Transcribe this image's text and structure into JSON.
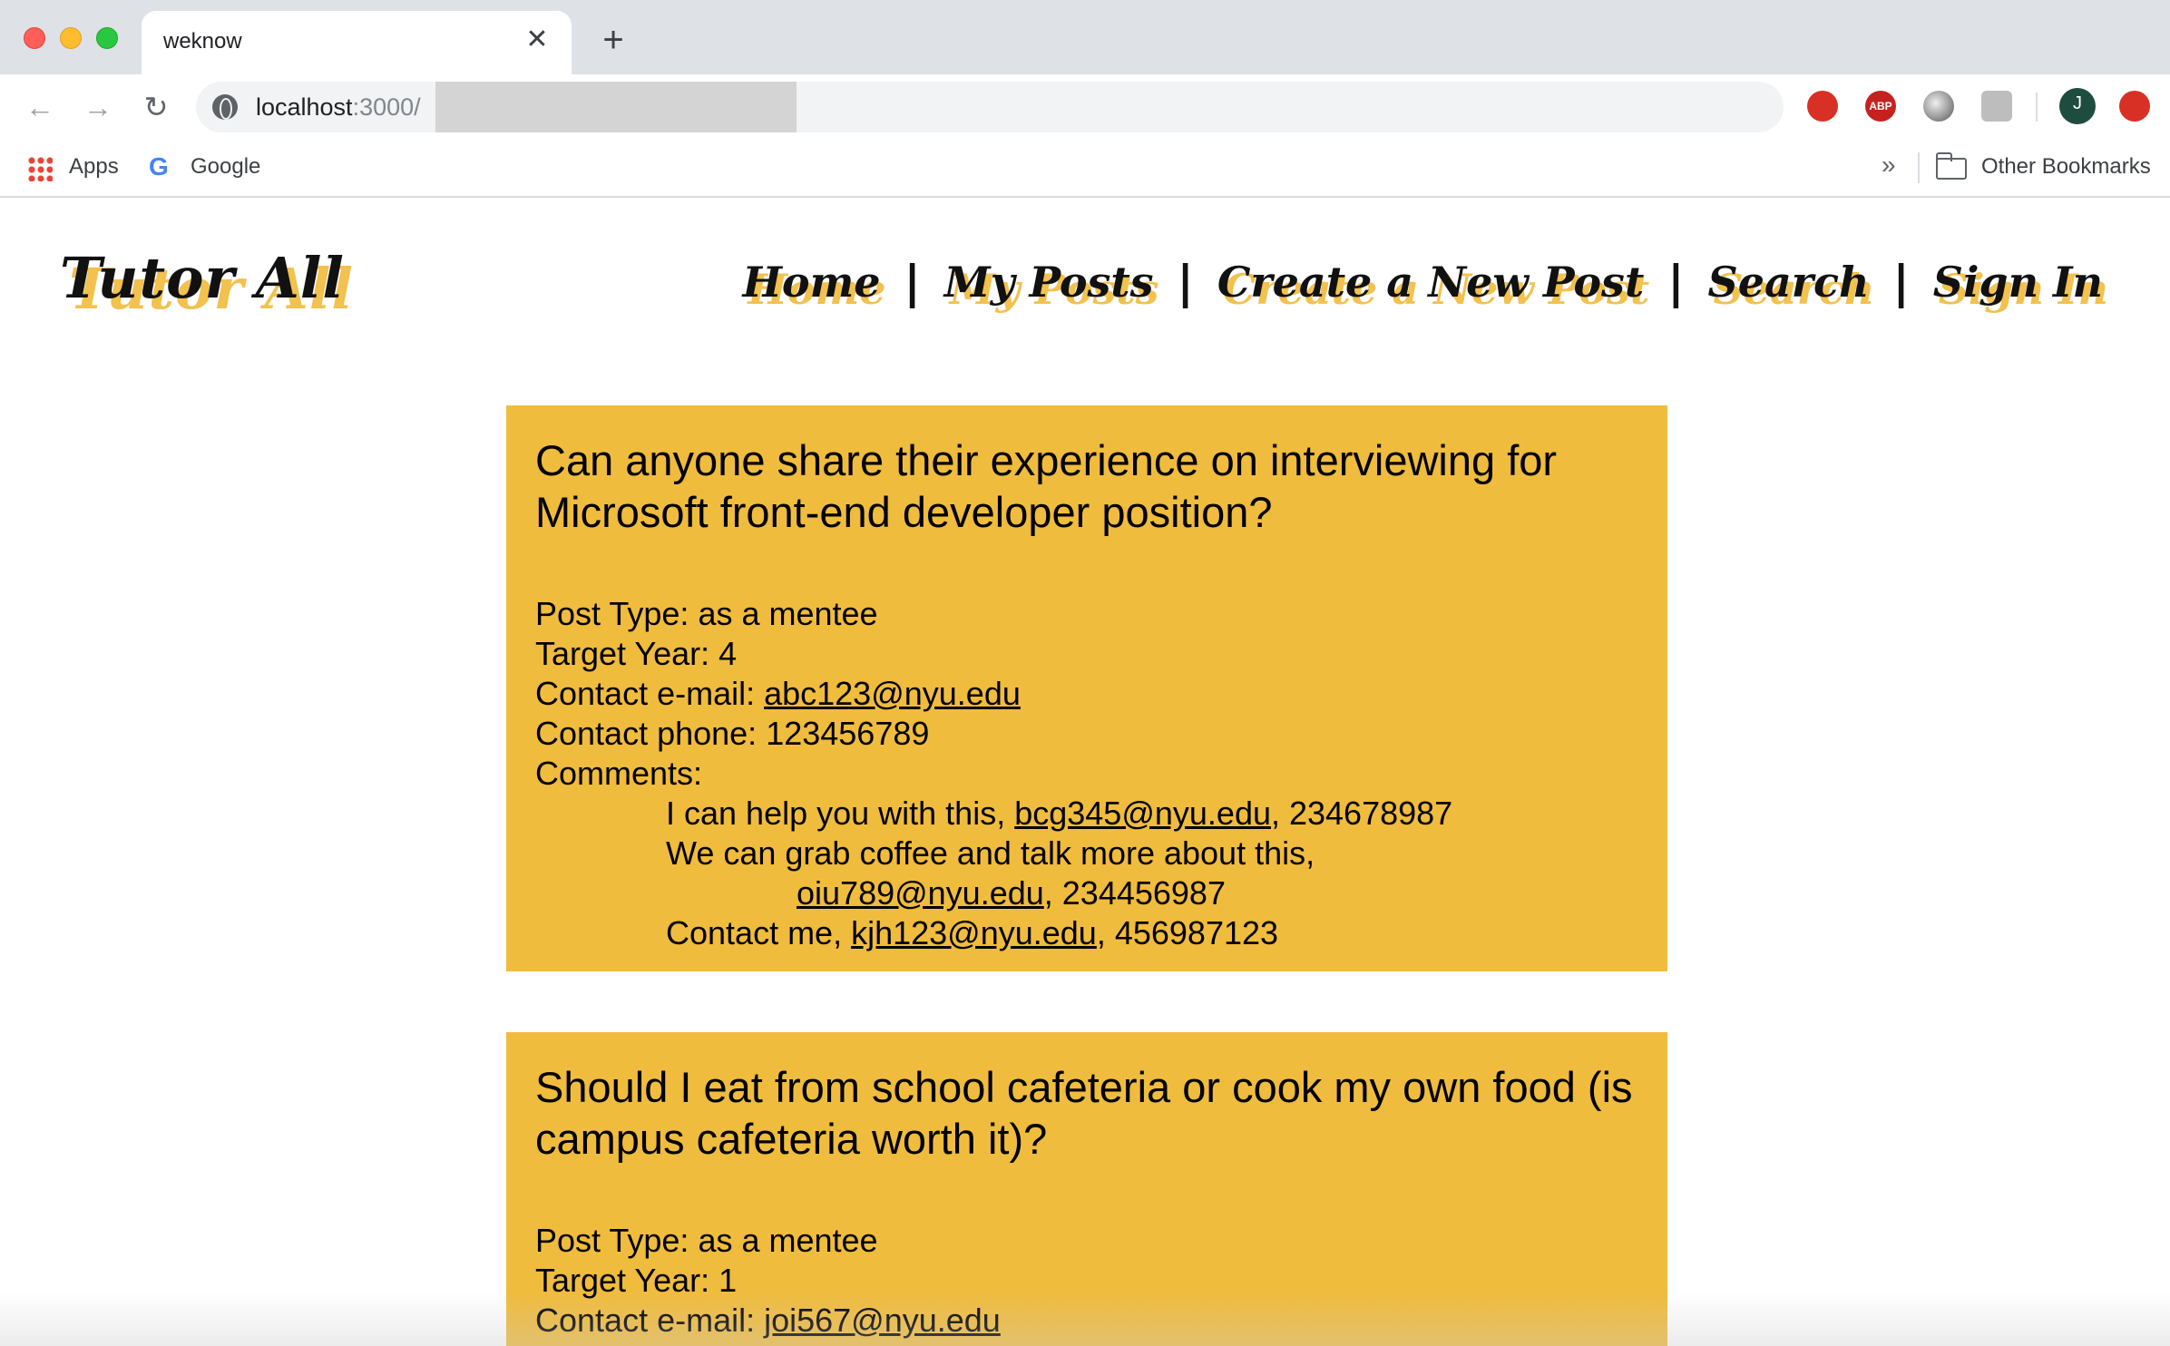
{
  "browser": {
    "tab_title": "weknow",
    "tab_close": "✕",
    "new_tab": "+",
    "url_host": "localhost",
    "url_rest": ":3000/",
    "back_icon": "←",
    "forward_icon": "→",
    "reload_icon": "↻",
    "extension_avatar_letter": "J",
    "extension_abp_label": "ABP",
    "bookmarks": {
      "apps": "Apps",
      "google_g": "G",
      "google": "Google",
      "more": "»",
      "other": "Other Bookmarks"
    }
  },
  "site": {
    "brand": "Tutor All",
    "nav": {
      "home": "Home",
      "my_posts": "My Posts",
      "create": "Create a New Post",
      "search": "Search",
      "sign_in": "Sign In",
      "separator": "|"
    }
  },
  "posts": [
    {
      "title": "Can anyone share their experience on interviewing for Microsoft front-end developer position?",
      "post_type_label": "Post Type: ",
      "post_type": "as a mentee",
      "target_year_label": "Target Year: ",
      "target_year": "4",
      "email_label": "Contact e-mail: ",
      "email": "abc123@nyu.edu",
      "phone_label": "Contact phone: ",
      "phone": "123456789",
      "comments_label": "Comments:",
      "comments": [
        {
          "text": "I can help you with this, ",
          "email": "bcg345@nyu.edu",
          "phone": ", 234678987"
        },
        {
          "text": "We can grab coffee and talk more about this, ",
          "email": "oiu789@nyu.edu",
          "phone": ", 234456987"
        },
        {
          "text": "Contact me, ",
          "email": "kjh123@nyu.edu",
          "phone": ", 456987123"
        }
      ]
    },
    {
      "title": "Should I eat from school cafeteria or cook my own food (is campus cafeteria worth it)?",
      "post_type_label": "Post Type: ",
      "post_type": "as a mentee",
      "target_year_label": "Target Year: ",
      "target_year": "1",
      "email_label": "Contact e-mail: ",
      "email": "joi567@nyu.edu"
    }
  ],
  "colors": {
    "post_background": "#f0bc3e",
    "brand_shadow": "#f2c14e"
  }
}
